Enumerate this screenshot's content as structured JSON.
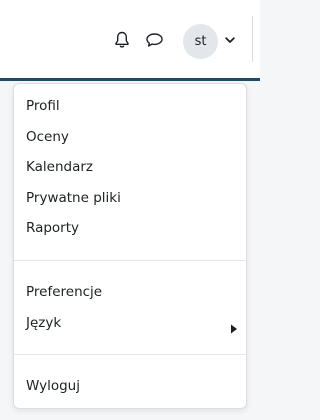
{
  "header": {
    "avatar_initials": "st",
    "icons": [
      "bell-icon",
      "chat-icon",
      "chevron-down-icon"
    ]
  },
  "menu": {
    "group1": [
      "Profil",
      "Oceny",
      "Kalendarz",
      "Prywatne pliki",
      "Raporty"
    ],
    "group2": [
      "Preferencje",
      "Język"
    ],
    "group3": [
      "Wyloguj"
    ]
  },
  "colors": {
    "navbar_border": "#1f4b66",
    "text": "#1d2125",
    "avatar_bg": "#e3e6ea"
  }
}
